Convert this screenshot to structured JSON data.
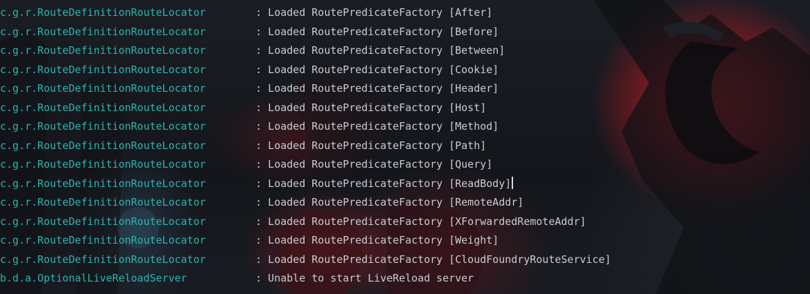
{
  "console": {
    "lines": [
      {
        "logger": "c.g.r.RouteDefinitionRouteLocator",
        "message": ": Loaded RoutePredicateFactory [After]"
      },
      {
        "logger": "c.g.r.RouteDefinitionRouteLocator",
        "message": ": Loaded RoutePredicateFactory [Before]"
      },
      {
        "logger": "c.g.r.RouteDefinitionRouteLocator",
        "message": ": Loaded RoutePredicateFactory [Between]"
      },
      {
        "logger": "c.g.r.RouteDefinitionRouteLocator",
        "message": ": Loaded RoutePredicateFactory [Cookie]"
      },
      {
        "logger": "c.g.r.RouteDefinitionRouteLocator",
        "message": ": Loaded RoutePredicateFactory [Header]"
      },
      {
        "logger": "c.g.r.RouteDefinitionRouteLocator",
        "message": ": Loaded RoutePredicateFactory [Host]"
      },
      {
        "logger": "c.g.r.RouteDefinitionRouteLocator",
        "message": ": Loaded RoutePredicateFactory [Method]"
      },
      {
        "logger": "c.g.r.RouteDefinitionRouteLocator",
        "message": ": Loaded RoutePredicateFactory [Path]"
      },
      {
        "logger": "c.g.r.RouteDefinitionRouteLocator",
        "message": ": Loaded RoutePredicateFactory [Query]"
      },
      {
        "logger": "c.g.r.RouteDefinitionRouteLocator",
        "message": ": Loaded RoutePredicateFactory [ReadBody]"
      },
      {
        "logger": "c.g.r.RouteDefinitionRouteLocator",
        "message": ": Loaded RoutePredicateFactory [RemoteAddr]"
      },
      {
        "logger": "c.g.r.RouteDefinitionRouteLocator",
        "message": ": Loaded RoutePredicateFactory [XForwardedRemoteAddr]"
      },
      {
        "logger": "c.g.r.RouteDefinitionRouteLocator",
        "message": ": Loaded RoutePredicateFactory [Weight]"
      },
      {
        "logger": "c.g.r.RouteDefinitionRouteLocator",
        "message": ": Loaded RoutePredicateFactory [CloudFoundryRouteService]"
      },
      {
        "logger": "b.d.a.OptionalLiveReloadServer",
        "message": ": Unable to start LiveReload server"
      }
    ],
    "caret_line": 9
  },
  "colors": {
    "logger": "#2fb3ad",
    "message": "#c9cdd3",
    "background": "#15171c",
    "accent_red": "#b32229"
  }
}
